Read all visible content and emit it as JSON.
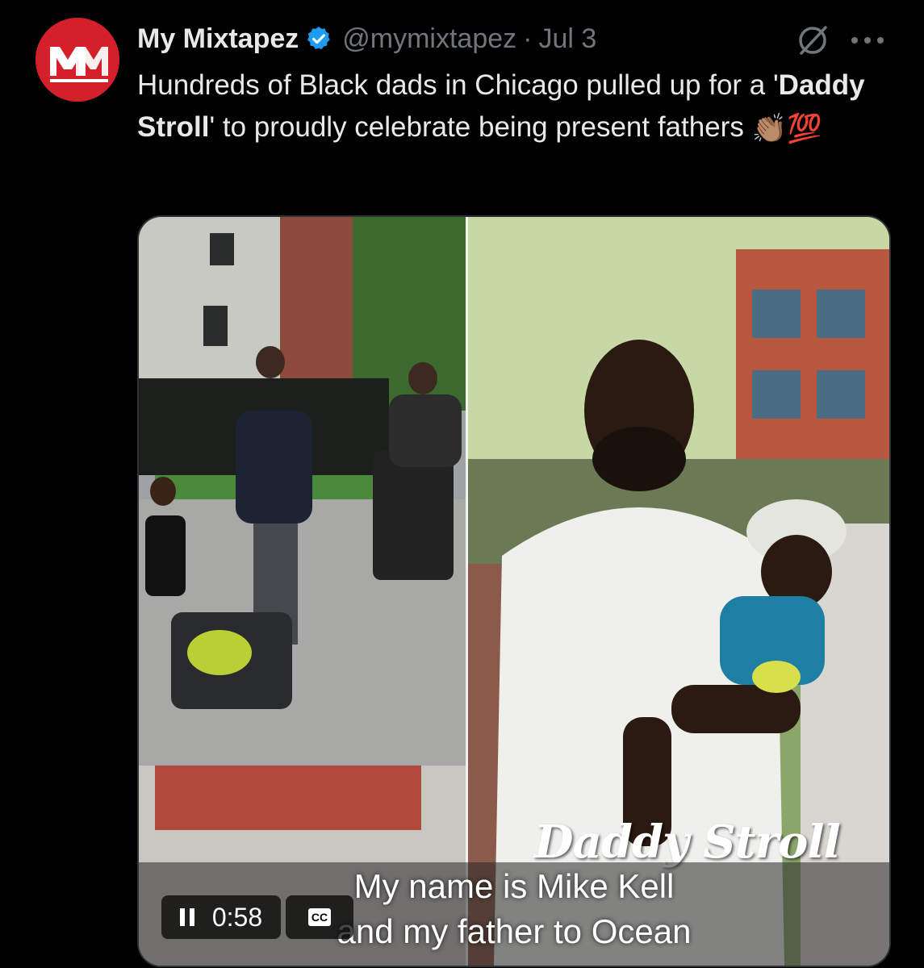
{
  "tweet": {
    "avatar_text": "MM",
    "display_name": "My Mixtapez",
    "verified": true,
    "handle": "@mymixtapez",
    "separator": "·",
    "date": "Jul 3",
    "text_part1": "Hundreds of Black dads in Chicago pulled up for a '",
    "text_bold": "Daddy Stroll",
    "text_part2": "' to proudly celebrate being present fathers",
    "emojis": "👏🏽💯"
  },
  "video": {
    "watermark": "Daddy Stroll",
    "caption_line1": "My name is Mike Kell",
    "caption_line2": "and my father to Ocean",
    "time": "0:58",
    "cc_label": "CC"
  },
  "colors": {
    "background": "#000000",
    "brand_red": "#d3202b",
    "verified_blue": "#1d9bf0",
    "muted": "#71767b"
  },
  "icons": [
    "avatar-logo",
    "verified-badge-icon",
    "grok-icon",
    "more-icon",
    "pause-icon",
    "closed-captions-icon"
  ]
}
